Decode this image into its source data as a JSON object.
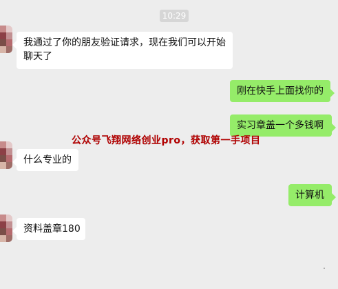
{
  "chat": {
    "timestamp": "10:29",
    "messages": [
      {
        "side": "left",
        "line1": "我通过了你的朋友验证请求，现在我们可以开始",
        "line2": "聊天了"
      },
      {
        "side": "right",
        "text": "刚在快手上面找你的"
      },
      {
        "side": "right",
        "text": "实习章盖一个多钱啊"
      },
      {
        "side": "left",
        "text": "什么专业的"
      },
      {
        "side": "right",
        "text": "计算机"
      },
      {
        "side": "left",
        "text": "资料盖章180"
      }
    ]
  },
  "watermark": {
    "text": "公众号飞翔网络创业pro，获取第一手项目"
  },
  "colors": {
    "background": "#ededed",
    "left_bubble": "#ffffff",
    "right_bubble": "#95ec69",
    "watermark": "#b30000"
  }
}
